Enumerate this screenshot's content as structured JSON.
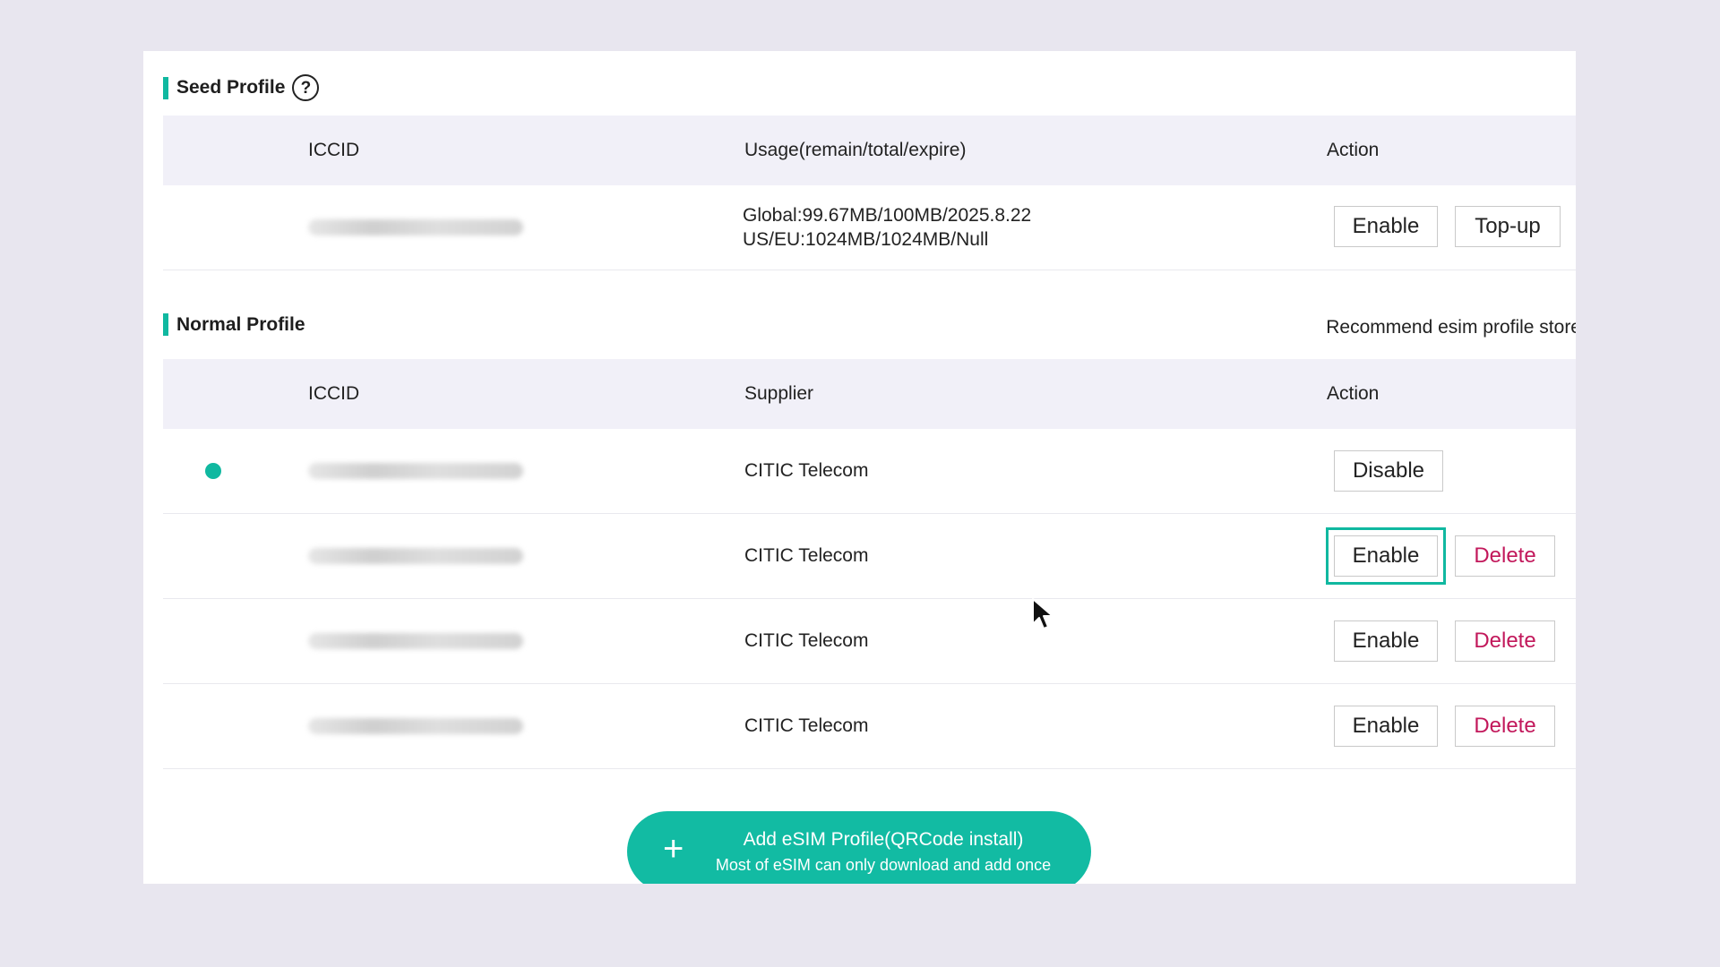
{
  "seed": {
    "title": "Seed Profile",
    "help_glyph": "?",
    "headers": {
      "iccid": "ICCID",
      "usage": "Usage(remain/total/expire)",
      "action": "Action"
    },
    "row": {
      "usage_line1": "Global:99.67MB/100MB/2025.8.22",
      "usage_line2": "US/EU:1024MB/1024MB/Null",
      "enable_label": "Enable",
      "topup_label": "Top-up"
    }
  },
  "normal": {
    "title": "Normal Profile",
    "recommend_link": "Recommend esim profile store",
    "headers": {
      "iccid": "ICCID",
      "supplier": "Supplier",
      "action": "Action"
    },
    "rows": [
      {
        "supplier": "CITIC Telecom",
        "active": true,
        "primary_label": "Disable"
      },
      {
        "supplier": "CITIC Telecom",
        "active": false,
        "primary_label": "Enable",
        "delete_label": "Delete"
      },
      {
        "supplier": "CITIC Telecom",
        "active": false,
        "primary_label": "Enable",
        "delete_label": "Delete"
      },
      {
        "supplier": "CITIC Telecom",
        "active": false,
        "primary_label": "Enable",
        "delete_label": "Delete"
      }
    ]
  },
  "add_button": {
    "icon": "plus-icon",
    "title": "Add eSIM Profile(QRCode install)",
    "subtitle": "Most of eSIM can only download and add once"
  },
  "colors": {
    "accent": "#10b8a0",
    "danger": "#c2185b",
    "header_bg": "#f1f0f8",
    "page_bg": "#e8e6ef"
  }
}
